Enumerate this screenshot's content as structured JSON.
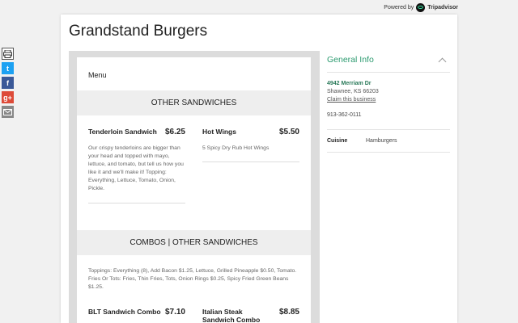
{
  "header": {
    "powered_by": "Powered by",
    "brand": "Tripadvisor"
  },
  "share": {
    "twitter_glyph": "t",
    "facebook_glyph": "f",
    "googleplus_glyph": "g+"
  },
  "restaurant": {
    "name": "Grandstand Burgers"
  },
  "menu": {
    "label": "Menu",
    "sections": [
      {
        "title": "OTHER SANDWICHES",
        "items": [
          {
            "name": "Tenderloin Sandwich",
            "price": "$6.25",
            "description": "Our crispy tenderloins are bigger than your head and topped with mayo, lettuce, and tomato, but tell us how you like it and we'll make it! Topping: Everything, Lettuce, Tomato, Onion, Pickle."
          },
          {
            "name": "Hot Wings",
            "price": "$5.50",
            "description": "5 Spicy Dry Rub Hot Wings"
          }
        ]
      },
      {
        "title": "COMBOS | OTHER SANDWICHES",
        "notes": "Toppings: Everything (8), Add Bacon $1.25, Lettuce, Grilled Pineapple $0.50, Tomato. Fries Or Tots: Fries, Thin Fries, Tots, Onion Rings $0.25, Spicy Fried Green Beans $1.25.",
        "items": [
          {
            "name": "BLT Sandwich Combo",
            "price": "$7.10"
          },
          {
            "name": "Italian Steak Sandwich Combo",
            "price": "$8.85"
          }
        ]
      }
    ]
  },
  "info": {
    "title": "General Info",
    "address_line1": "4942 Merriam Dr",
    "address_line2": "Shawnee, KS 66203",
    "claim_link": "Claim this business",
    "phone": "913-362-0111",
    "cuisine_label": "Cuisine",
    "cuisine_value": "Hamburgers"
  },
  "colors": {
    "accent": "#2b9a6f",
    "section_bg": "#eeeeee",
    "frame_bg": "#dcdcdc"
  }
}
